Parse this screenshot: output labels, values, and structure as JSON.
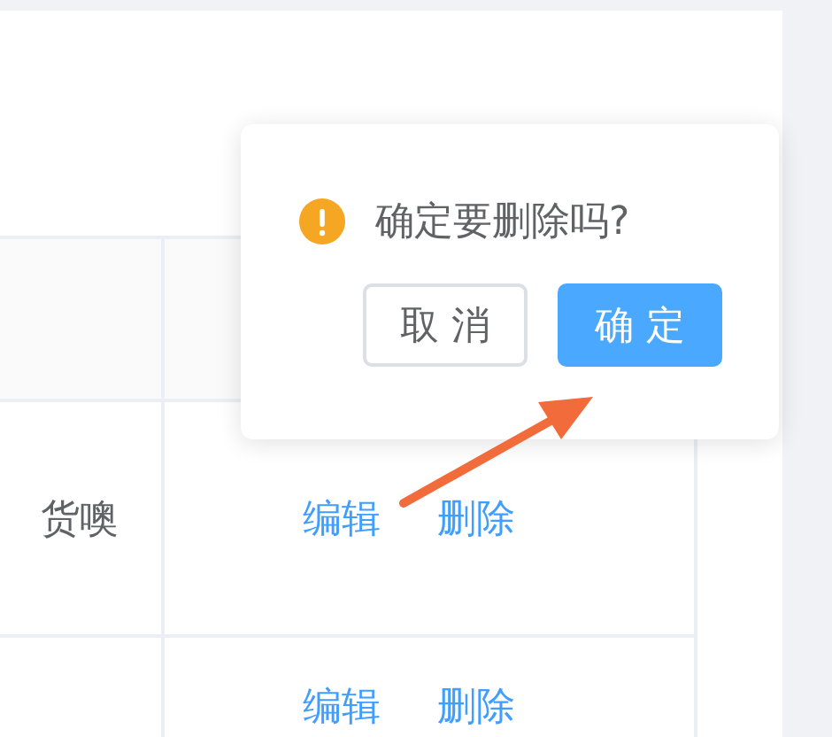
{
  "table": {
    "rows": [
      {
        "column_1": "货噢",
        "actions": [
          "编辑",
          "删除"
        ]
      },
      {
        "actions": [
          "编辑",
          "删除"
        ]
      }
    ]
  },
  "popconfirm": {
    "message": "确定要删除吗?",
    "buttons": [
      {
        "label": "取 消",
        "kind": "secondary"
      },
      {
        "label": "确 定",
        "kind": "primary"
      }
    ]
  }
}
